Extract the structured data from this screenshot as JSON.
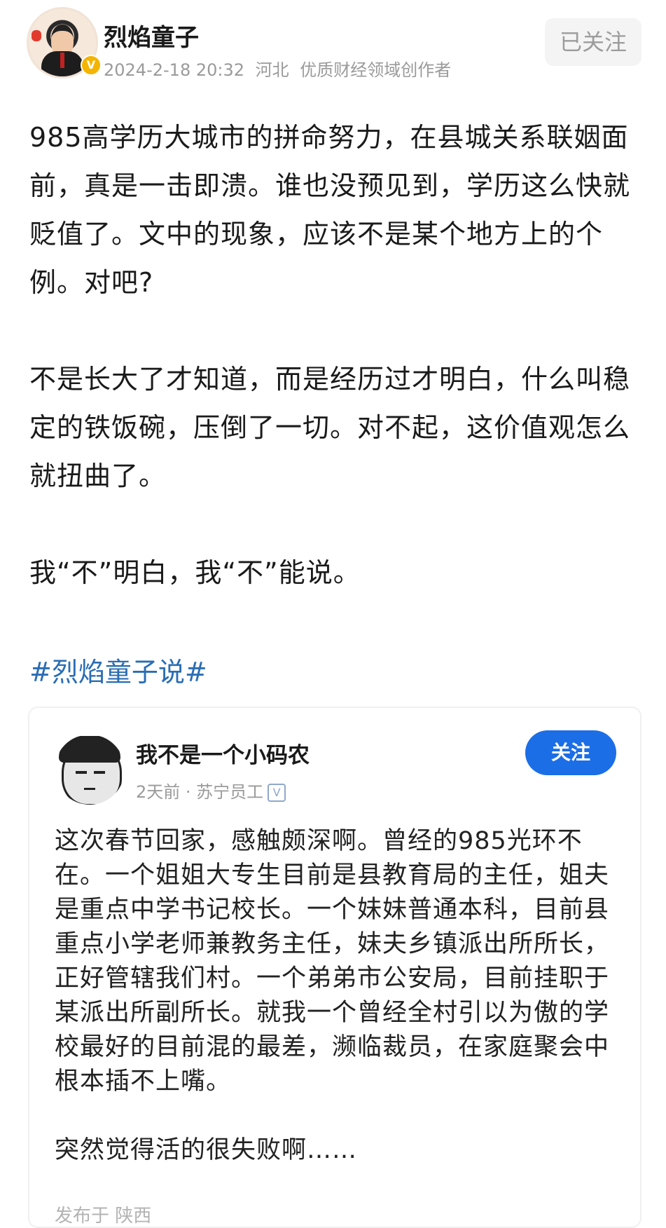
{
  "author": {
    "name": "烈焰童子",
    "date": "2024-2-18 20:32",
    "location": "河北",
    "tag": "优质财经领域创作者",
    "follow_label": "已关注",
    "verified_mark": "V"
  },
  "post": {
    "paragraphs": [
      "985高学历大城市的拼命努力，在县城关系联姻面前，真是一击即溃。谁也没预见到，学历这么快就贬值了。文中的现象，应该不是某个地方上的个例。对吧?",
      "不是长大了才知道，而是经历过才明白，什么叫稳定的铁饭碗，压倒了一切。对不起，这价值观怎么就扭曲了。",
      "我“不”明白，我“不”能说。"
    ],
    "hashtag": "#烈焰童子说#"
  },
  "quoted": {
    "name": "我不是一个小码农",
    "meta": "2天前 · 苏宁员工",
    "verified_mark": "V",
    "follow_label": "关注",
    "paragraphs": [
      "这次春节回家，感触颇深啊。曾经的985光环不在。一个姐姐大专生目前是县教育局的主任，姐夫是重点中学书记校长。一个妹妹普通本科，目前县重点小学老师兼教务主任，妹夫乡镇派出所所长，正好管辖我们村。一个弟弟市公安局，目前挂职于某派出所副所长。就我一个曾经全村引以为傲的学校最好的目前混的最差，濒临裁员，在家庭聚会中根本插不上嘴。",
      "突然觉得活的很失败啊……"
    ],
    "footer": "发布于 陕西"
  },
  "colors": {
    "hashtag": "#2a6db4",
    "follow_button": "#1b6ee6",
    "meta_text": "#9a9a9a"
  }
}
